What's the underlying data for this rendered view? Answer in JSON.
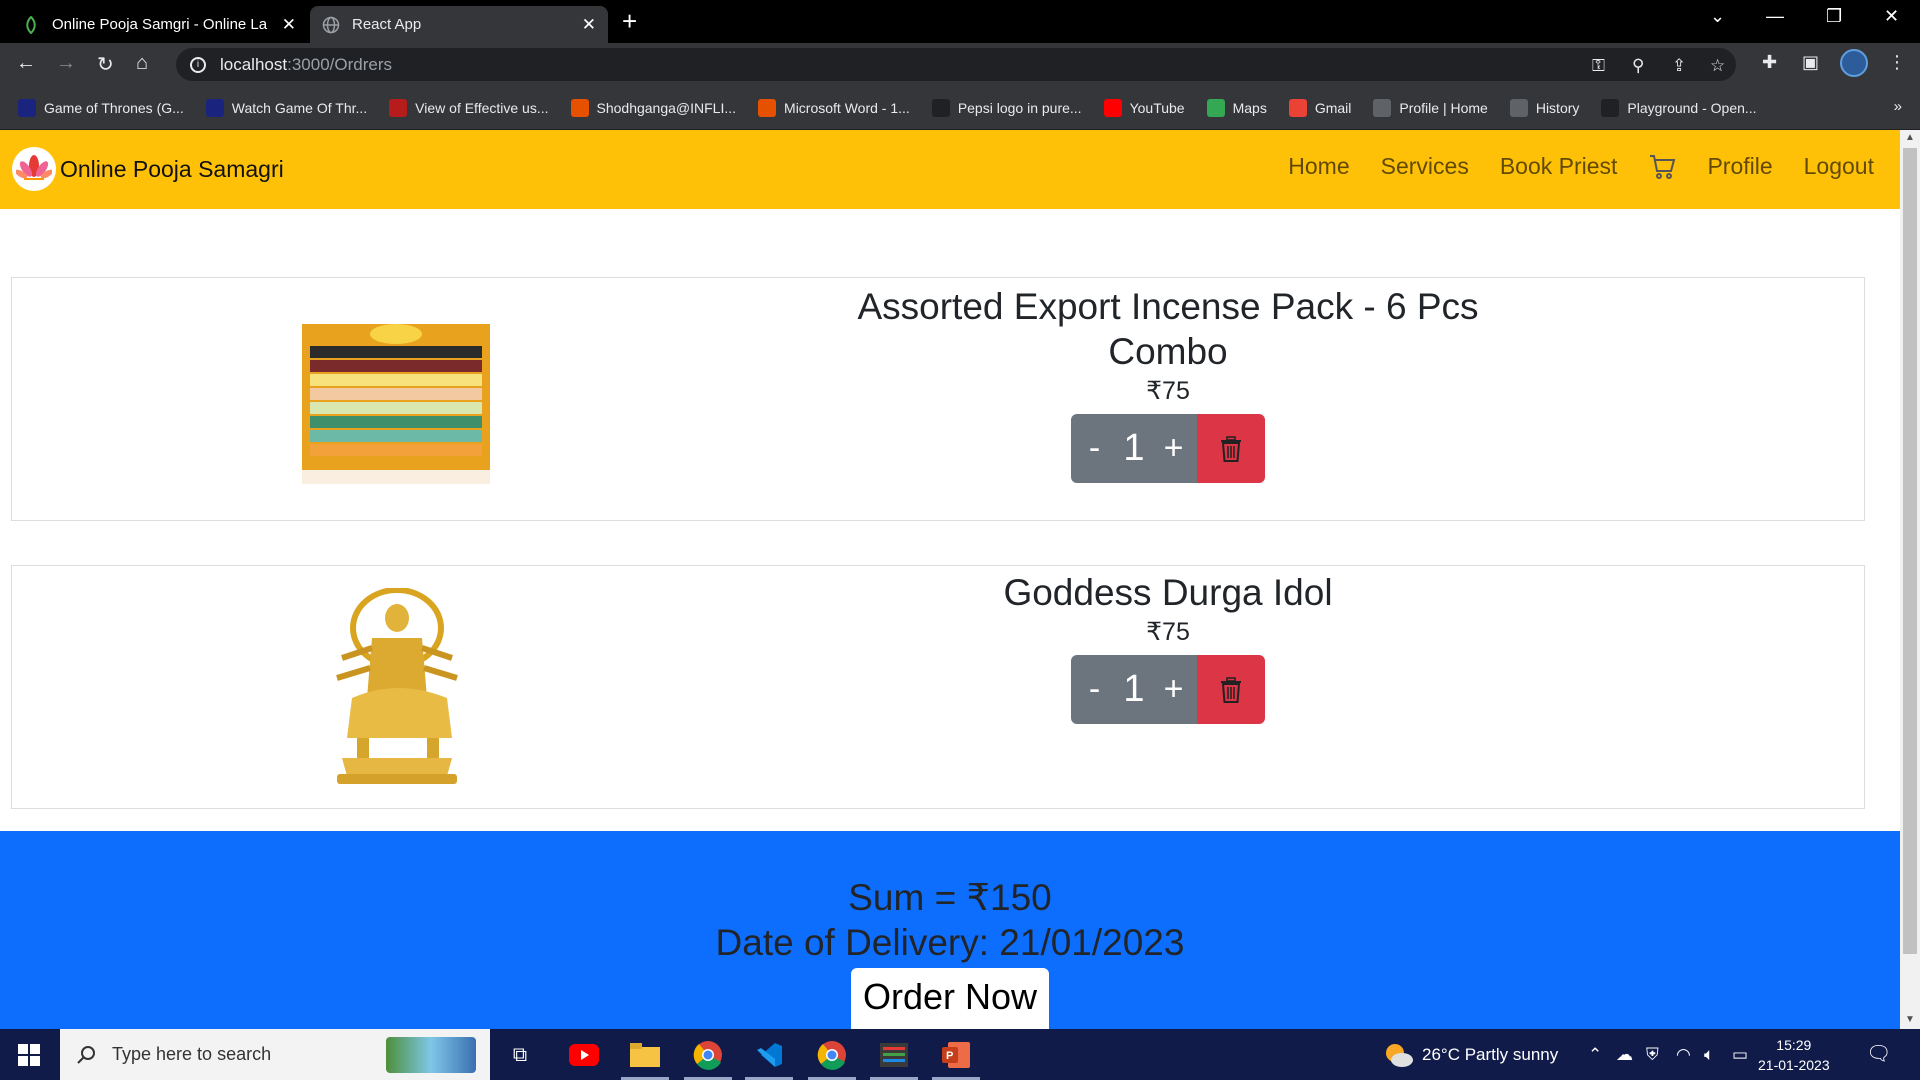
{
  "browser": {
    "tabs": [
      {
        "title": "Online Pooja Samgri - Online La",
        "active": false
      },
      {
        "title": "React App",
        "active": true
      }
    ],
    "url_host": "localhost",
    "url_path": ":3000/Ordrers",
    "bookmarks": [
      {
        "label": "Game of Thrones (G...",
        "icon": "bh-icon",
        "color": "#1a237e"
      },
      {
        "label": "Watch Game Of Thr...",
        "icon": "bh-icon",
        "color": "#1a237e"
      },
      {
        "label": "View of Effective us...",
        "icon": "fm-icon",
        "color": "#b71c1c"
      },
      {
        "label": "Shodhganga@INFLI...",
        "icon": "shodh-icon",
        "color": "#e65100"
      },
      {
        "label": "Microsoft Word - 1...",
        "icon": "shodh-icon",
        "color": "#e65100"
      },
      {
        "label": "Pepsi logo in pure...",
        "icon": "codepen-icon",
        "color": "#202124"
      },
      {
        "label": "YouTube",
        "icon": "youtube-icon",
        "color": "#ff0000"
      },
      {
        "label": "Maps",
        "icon": "maps-icon",
        "color": "#34a853"
      },
      {
        "label": "Gmail",
        "icon": "gmail-icon",
        "color": "#ea4335"
      },
      {
        "label": "Profile | Home",
        "icon": "profile-icon",
        "color": "#5f6368"
      },
      {
        "label": "History",
        "icon": "history-icon",
        "color": "#5f6368"
      },
      {
        "label": "Playground - Open...",
        "icon": "openai-icon",
        "color": "#202124"
      }
    ]
  },
  "app": {
    "brand": "Online Pooja Samagri",
    "nav": {
      "home": "Home",
      "services": "Services",
      "book_priest": "Book Priest",
      "profile": "Profile",
      "logout": "Logout"
    },
    "colors": {
      "navbar": "#ffc107",
      "summary": "#0d6efd",
      "delete": "#dc3545",
      "qty": "#6c757d"
    },
    "items": [
      {
        "title": "Assorted Export Incense Pack - 6 Pcs Combo",
        "price": "₹75",
        "qty": "1",
        "minus": "-",
        "plus": "+"
      },
      {
        "title": "Goddess Durga Idol",
        "price": "₹75",
        "qty": "1",
        "minus": "-",
        "plus": "+"
      }
    ],
    "summary": {
      "sum": "Sum = ₹150",
      "delivery": "Date of Delivery: 21/01/2023",
      "order_button": "Order Now"
    }
  },
  "taskbar": {
    "search_placeholder": "Type here to search",
    "weather": "26°C  Partly sunny",
    "time": "15:29",
    "date": "21-01-2023"
  }
}
